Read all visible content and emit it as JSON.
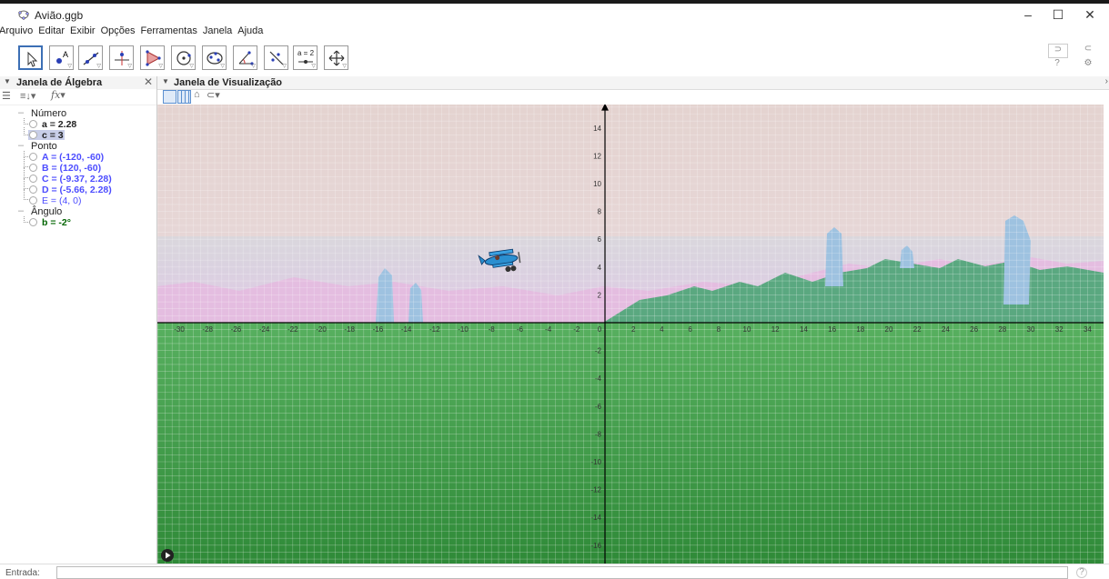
{
  "window": {
    "title": "Avião.ggb",
    "minimize": "–",
    "maximize": "☐",
    "close": "✕"
  },
  "menu": [
    "Arquivo",
    "Editar",
    "Exibir",
    "Opções",
    "Ferramentas",
    "Janela",
    "Ajuda"
  ],
  "toolbar": {
    "tools": [
      "move-tool",
      "point-tool",
      "line-tool",
      "perpendicular-tool",
      "polygon-tool",
      "circle-tool",
      "conic-tool",
      "angle-tool",
      "reflect-tool",
      "slider-tool",
      "move-view-tool"
    ],
    "slider_label": "a = 2",
    "undo": "⊃",
    "redo": "⊂",
    "help": "?",
    "settings": "⚙"
  },
  "algebra": {
    "title": "Janela de Álgebra",
    "close": "✕",
    "groups": [
      {
        "name": "Número",
        "items": [
          {
            "text": "a = 2.28",
            "color": "#000000"
          },
          {
            "text": "c = 3",
            "color": "#000000"
          }
        ]
      },
      {
        "name": "Ponto",
        "items": [
          {
            "text": "A = (-120, -60)",
            "color": "#4d4dff"
          },
          {
            "text": "B = (120, -60)",
            "color": "#4d4dff"
          },
          {
            "text": "C = (-9.37, 2.28)",
            "color": "#4d4dff"
          },
          {
            "text": "D = (-5.66, 2.28)",
            "color": "#4d4dff"
          },
          {
            "text": "E = (4, 0)",
            "color": "#4d4dff"
          }
        ]
      },
      {
        "name": "Ângulo",
        "items": [
          {
            "text": "b = -2°",
            "color": "#006400"
          }
        ]
      }
    ]
  },
  "graphics": {
    "title": "Janela de Visualização",
    "x_ticks": [
      "-30",
      "-28",
      "-26",
      "-24",
      "-22",
      "-20",
      "-18",
      "-16",
      "-14",
      "-12",
      "-10",
      "-8",
      "-6",
      "-4",
      "-2",
      "0",
      "2",
      "4",
      "6",
      "8",
      "10",
      "12",
      "14",
      "16",
      "18",
      "20",
      "22",
      "24",
      "26",
      "28",
      "30",
      "32",
      "34"
    ],
    "y_ticks_pos": [
      "14",
      "12",
      "10",
      "8",
      "6",
      "4",
      "2"
    ],
    "y_ticks_neg": [
      "-2",
      "-4",
      "-6",
      "-8",
      "-10",
      "-12",
      "-14",
      "-16"
    ]
  },
  "input": {
    "label": "Entrada:",
    "help": "?"
  },
  "colors": {
    "sky": "#e8d8d8",
    "ground": "#3f9a48",
    "axis": "#000000",
    "plane": "#2a8fd0"
  }
}
